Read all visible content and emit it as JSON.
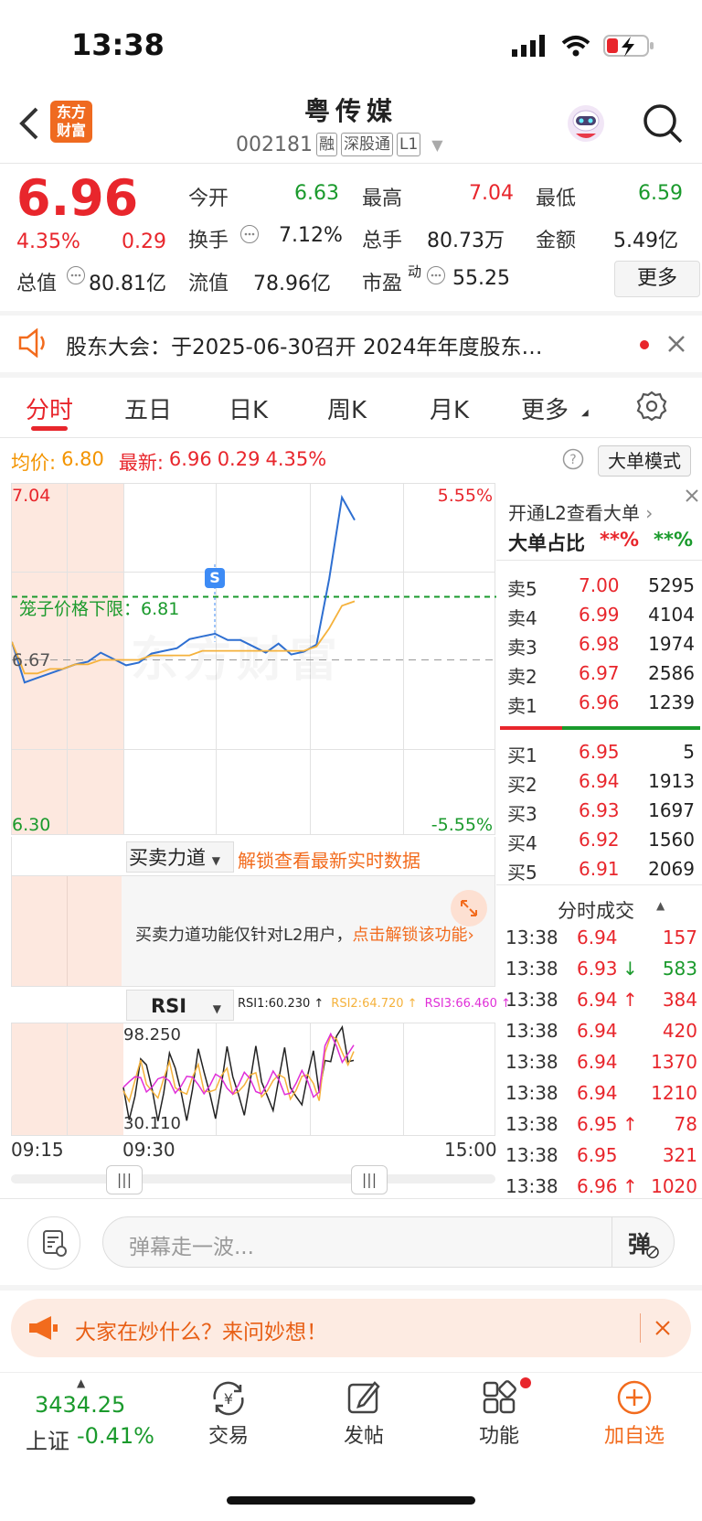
{
  "status": {
    "time": "13:38"
  },
  "header": {
    "logo_text": "东方\n财富",
    "title": "粤传媒",
    "code": "002181",
    "tags": [
      "融",
      "深股通",
      "L1"
    ]
  },
  "quote": {
    "price": "6.96",
    "change_pct": "4.35%",
    "change": "0.29",
    "open_label": "今开",
    "open": "6.63",
    "high_label": "最高",
    "high": "7.04",
    "low_label": "最低",
    "low": "6.59",
    "turnover_label": "换手",
    "turnover": "7.12%",
    "volume_label": "总手",
    "volume": "80.73万",
    "amount_label": "金额",
    "amount": "5.49亿",
    "mktcap_label": "总值",
    "mktcap": "80.81亿",
    "float_label": "流值",
    "float": "78.96亿",
    "pe_label": "市盈",
    "pe_sup": "动",
    "pe": "55.25",
    "more": "更多"
  },
  "notice": {
    "text": "股东大会：于2025-06-30召开 2024年年度股东…"
  },
  "tabs": [
    {
      "label": "分时",
      "active": true
    },
    {
      "label": "五日"
    },
    {
      "label": "日K"
    },
    {
      "label": "周K"
    },
    {
      "label": "月K"
    },
    {
      "label": "更多"
    }
  ],
  "info_line": {
    "avg_label": "均价:",
    "avg": "6.80",
    "last_label": "最新:",
    "last": "6.96",
    "chg": "0.29",
    "pct": "4.35%",
    "mode_button": "大单模式"
  },
  "chart": {
    "y_top": "7.04",
    "y_bottom": "6.30",
    "y_mid": "6.67",
    "pct_top": "5.55%",
    "pct_bottom": "-5.55%",
    "limit_label": "笼子价格下限：6.81",
    "marker": "S",
    "watermark": "东方财富",
    "time_start": "09:15",
    "time_mid": "09:30",
    "time_end": "15:00"
  },
  "chart_data": {
    "type": "line",
    "title": "",
    "series": [
      {
        "values": [
          6.71,
          6.62,
          6.63,
          6.64,
          6.65,
          6.66,
          6.67,
          6.68,
          6.67,
          6.66,
          6.67,
          6.68,
          6.69,
          6.7,
          6.71,
          6.72,
          6.73,
          6.72,
          6.71,
          6.7,
          6.69,
          6.7,
          6.68,
          6.69,
          6.71,
          6.85,
          7.03,
          6.98
        ]
      },
      {
        "values": [
          6.71,
          6.64,
          6.64,
          6.65,
          6.65,
          6.66,
          6.66,
          6.67,
          6.67,
          6.67,
          6.67,
          6.68,
          6.68,
          6.68,
          6.68,
          6.69,
          6.69,
          6.69,
          6.69,
          6.69,
          6.69,
          6.69,
          6.69,
          6.69,
          6.7,
          6.74,
          6.79,
          6.8
        ]
      }
    ],
    "ylim": [
      6.3,
      7.04
    ],
    "xlabel": "",
    "ylabel": ""
  },
  "power": {
    "dropdown": "买卖力道",
    "unlock": "解锁查看最新实时数据",
    "info": "买卖力道功能仅针对L2用户，",
    "info_link": "点击解锁该功能"
  },
  "rsi": {
    "dropdown": "RSI",
    "rsi1": "RSI1:60.230 ↑",
    "rsi2": "RSI2:64.720 ↑",
    "rsi3": "RSI3:66.460 ↑",
    "top": "98.250",
    "bottom": "30.110"
  },
  "orderbook": {
    "promo": "开通L2查看大单",
    "big_label": "大单占比",
    "big1": "**%",
    "big2": "**%",
    "asks": [
      {
        "label": "卖5",
        "price": "7.00",
        "vol": "5295"
      },
      {
        "label": "卖4",
        "price": "6.99",
        "vol": "4104"
      },
      {
        "label": "卖3",
        "price": "6.98",
        "vol": "1974"
      },
      {
        "label": "卖2",
        "price": "6.97",
        "vol": "2586"
      },
      {
        "label": "卖1",
        "price": "6.96",
        "vol": "1239"
      }
    ],
    "bids": [
      {
        "label": "买1",
        "price": "6.95",
        "vol": "5"
      },
      {
        "label": "买2",
        "price": "6.94",
        "vol": "1913"
      },
      {
        "label": "买3",
        "price": "6.93",
        "vol": "1697"
      },
      {
        "label": "买4",
        "price": "6.92",
        "vol": "1560"
      },
      {
        "label": "买5",
        "price": "6.91",
        "vol": "2069"
      }
    ]
  },
  "trades": {
    "title": "分时成交",
    "rows": [
      {
        "time": "13:38",
        "price": "6.94",
        "dir": "",
        "vol": "157"
      },
      {
        "time": "13:38",
        "price": "6.93",
        "dir": "↓",
        "vol": "583"
      },
      {
        "time": "13:38",
        "price": "6.94",
        "dir": "↑",
        "vol": "384"
      },
      {
        "time": "13:38",
        "price": "6.94",
        "dir": "",
        "vol": "420"
      },
      {
        "time": "13:38",
        "price": "6.94",
        "dir": "",
        "vol": "1370"
      },
      {
        "time": "13:38",
        "price": "6.94",
        "dir": "",
        "vol": "1210"
      },
      {
        "time": "13:38",
        "price": "6.95",
        "dir": "↑",
        "vol": "78"
      },
      {
        "time": "13:38",
        "price": "6.95",
        "dir": "",
        "vol": "321"
      },
      {
        "time": "13:38",
        "price": "6.96",
        "dir": "↑",
        "vol": "1020"
      }
    ]
  },
  "comment": {
    "placeholder": "弹幕走一波...",
    "danmu": "弹"
  },
  "ask_banner": {
    "text": "大家在炒什么？来问妙想！"
  },
  "bottom_nav": {
    "index_value": "3434.25",
    "index_name": "上证",
    "index_pct": "-0.41%",
    "trade": "交易",
    "post": "发帖",
    "func": "功能",
    "add": "加自选"
  }
}
